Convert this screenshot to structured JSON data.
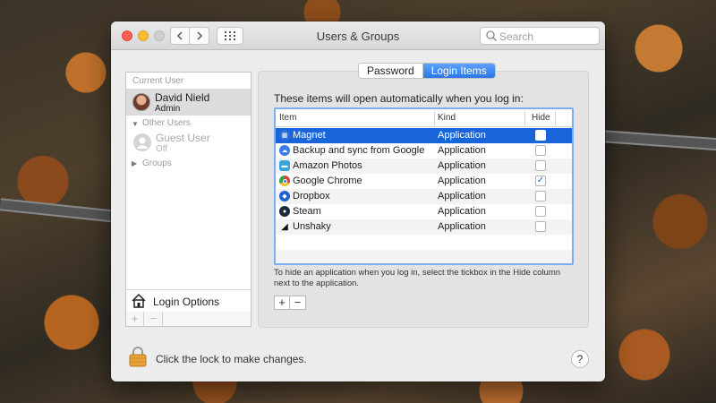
{
  "window": {
    "title": "Users & Groups"
  },
  "toolbar": {
    "back_icon": "chevron-left-icon",
    "forward_icon": "chevron-right-icon",
    "grid_icon": "grid-icon",
    "search_placeholder": "Search"
  },
  "sidebar": {
    "current_user_heading": "Current User",
    "current_user": {
      "name": "David Nield",
      "role": "Admin"
    },
    "other_users_heading": "Other Users",
    "guest": {
      "name": "Guest User",
      "status": "Off"
    },
    "groups_heading": "Groups",
    "login_options_label": "Login Options",
    "add_label": "+",
    "remove_label": "−"
  },
  "tabs": [
    {
      "label": "Password"
    },
    {
      "label": "Login Items",
      "active": true
    }
  ],
  "main": {
    "intro": "These items will open automatically when you log in:",
    "columns": {
      "item": "Item",
      "kind": "Kind",
      "hide": "Hide"
    },
    "items": [
      {
        "name": "Magnet",
        "kind": "Application",
        "hide": false,
        "selected": true,
        "icon": "magnet-icon",
        "icon_color": "#2d6fd6"
      },
      {
        "name": "Backup and sync from Google",
        "kind": "Application",
        "hide": false,
        "icon": "cloud-icon",
        "icon_color": "#3b7be9"
      },
      {
        "name": "Amazon Photos",
        "kind": "Application",
        "hide": false,
        "icon": "amazon-photos-icon",
        "icon_color": "#3aa3d8"
      },
      {
        "name": "Google Chrome",
        "kind": "Application",
        "hide": true,
        "icon": "chrome-icon",
        "icon_color": "#e0402f"
      },
      {
        "name": "Dropbox",
        "kind": "Application",
        "hide": false,
        "icon": "dropbox-icon",
        "icon_color": "#1c62d6"
      },
      {
        "name": "Steam",
        "kind": "Application",
        "hide": false,
        "icon": "steam-icon",
        "icon_color": "#1b2a3d"
      },
      {
        "name": "Unshaky",
        "kind": "Application",
        "hide": false,
        "icon": "unshaky-icon",
        "icon_color": "#111111"
      }
    ],
    "hint": "To hide an application when you log in, select the tickbox in the Hide column next to the application.",
    "add_label": "+",
    "remove_label": "−"
  },
  "footer": {
    "lock_label": "Click the lock to make changes.",
    "help_label": "?"
  },
  "colors": {
    "selection": "#1765d8",
    "active_tab": "#2a77e9",
    "table_focus_ring": "#7eaef2"
  }
}
